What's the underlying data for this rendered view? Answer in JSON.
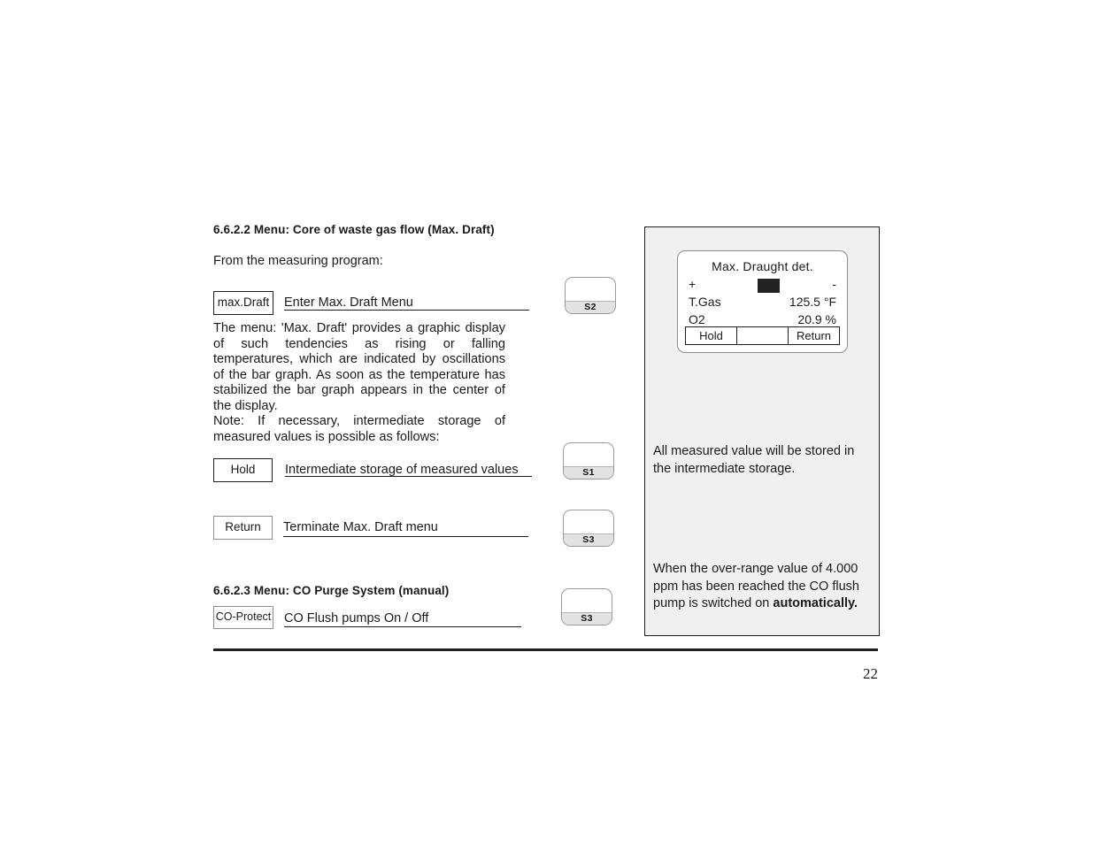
{
  "section_max_draft": {
    "heading": "6.6.2.2  Menu:  Core of waste gas flow (Max. Draft)",
    "intro": "From the measuring program:",
    "enter_key_label": "max.Draft",
    "enter_key_desc": "Enter Max. Draft Menu",
    "body": "The menu: 'Max. Draft' provides a graphic display of such tendencies as rising or falling temperatures, which are indicated by oscillations of the bar graph. As soon as the temperature has stabilized the bar graph appears in the center of the display.",
    "note": "Note: If necessary, intermediate storage of measured values is possible as follows:",
    "hold_key_label": "Hold",
    "hold_key_desc": "Intermediate storage of measured values",
    "return_key_label": "Return",
    "return_key_desc": "Terminate Max. Draft menu"
  },
  "section_co_purge": {
    "heading": "6.6.2.3  Menu:  CO Purge System (manual)",
    "key_label": "CO-Protect",
    "key_desc": "CO Flush pumps On / Off"
  },
  "hardware_keys": [
    {
      "name": "S2"
    },
    {
      "name": "S1"
    },
    {
      "name": "S3"
    },
    {
      "name": "S3"
    }
  ],
  "display": {
    "title": "Max. Draught  det.",
    "plus_sign": "+",
    "minus_sign": "-",
    "rows": [
      {
        "label": "T.Gas",
        "value": "125.5 °F"
      },
      {
        "label": "O2",
        "value": "20.9 %"
      }
    ],
    "softkeys": [
      "Hold",
      "",
      "Return"
    ]
  },
  "panel_notes": {
    "storage_note": "All measured value will be stored in the intermediate storage.",
    "overrange_note_prefix": "When the over-range value of 4.000 ppm has been reached the CO flush pump is switched on ",
    "overrange_note_bold": "automatically."
  },
  "footer": {
    "page_number": "22"
  }
}
